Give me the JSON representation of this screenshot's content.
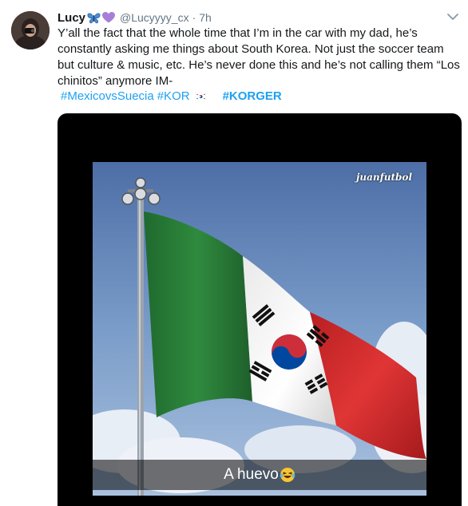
{
  "tweet": {
    "display_name": "Lucy",
    "handle": "@Lucyyyy_cx",
    "separator": "·",
    "time": "7h",
    "text": "Y’all the fact that the whole time that I’m in the car with my dad, he’s constantly asking me things about South Korea. Not just the soccer team but culture & music, etc. He’s never done this and he’s not calling them “Los chinitos” anymore IM-",
    "hashtags": [
      "#MexicovsSuecia",
      "#KOR",
      "#KORGER"
    ],
    "name_emojis": [
      "butterfly-icon",
      "purple-heart-icon"
    ]
  },
  "media": {
    "watermark": "juanfutbol",
    "caption": "A huevo",
    "caption_emoji": "laughing-tears-emoji"
  },
  "colors": {
    "link": "#1da1f2",
    "secondary_text": "#657786",
    "flag_green": "#2e7d3a",
    "flag_white": "#f2f2f2",
    "flag_red": "#d42a2a",
    "sky": "#6f94c4"
  }
}
